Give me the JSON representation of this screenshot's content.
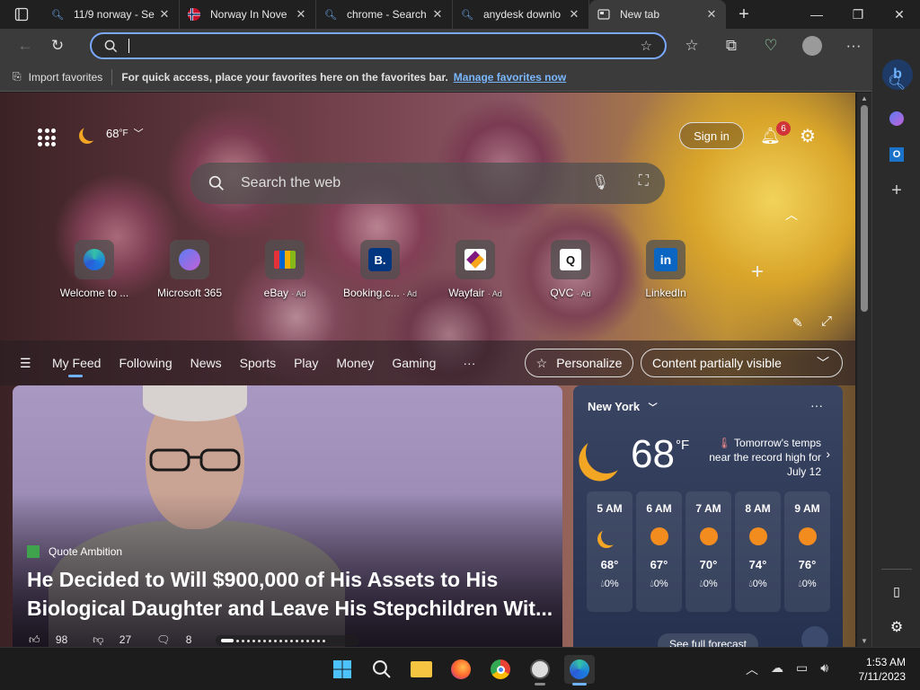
{
  "tabs": [
    {
      "label": "11/9 norway - Se",
      "icon": "search-favicon"
    },
    {
      "label": "Norway In Nove",
      "icon": "norway-flag-favicon"
    },
    {
      "label": "chrome - Search",
      "icon": "search-favicon"
    },
    {
      "label": "anydesk downlo",
      "icon": "search-favicon"
    },
    {
      "label": "New tab",
      "icon": "newtab-favicon",
      "active": true
    }
  ],
  "address": {
    "value": ""
  },
  "favorites_bar": {
    "import_label": "Import favorites",
    "message": "For quick access, place your favorites here on the favorites bar.",
    "manage_link": "Manage favorites now"
  },
  "header": {
    "weather_temp": "68",
    "weather_unit": "°F",
    "signin_label": "Sign in",
    "notification_count": "6"
  },
  "search": {
    "placeholder": "Search the web"
  },
  "quick_links": [
    {
      "label": "Welcome to ...",
      "ad": ""
    },
    {
      "label": "Microsoft 365",
      "ad": ""
    },
    {
      "label": "eBay",
      "ad": "· Ad"
    },
    {
      "label": "Booking.c...",
      "ad": "· Ad"
    },
    {
      "label": "Wayfair",
      "ad": "· Ad"
    },
    {
      "label": "QVC",
      "ad": "· Ad"
    },
    {
      "label": "LinkedIn",
      "ad": ""
    }
  ],
  "feed_tabs": [
    "My Feed",
    "Following",
    "News",
    "Sports",
    "Play",
    "Money",
    "Gaming",
    "···"
  ],
  "personalize_label": "Personalize",
  "content_visibility": "Content partially visible",
  "article": {
    "source": "Quote Ambition",
    "headline": "He Decided to Will $900,000 of His Assets to His Biological Daughter and Leave His Stepchildren Wit...",
    "likes": "98",
    "dislikes": "27",
    "comments": "8"
  },
  "weather": {
    "city": "New York",
    "temp": "68",
    "unit": "°F",
    "note": "Tomorrow's temps near the record high for July 12",
    "hours": [
      {
        "time": "5 AM",
        "temp": "68°",
        "precip": "0%",
        "icon": "moon"
      },
      {
        "time": "6 AM",
        "temp": "67°",
        "precip": "0%",
        "icon": "sun"
      },
      {
        "time": "7 AM",
        "temp": "70°",
        "precip": "0%",
        "icon": "sun"
      },
      {
        "time": "8 AM",
        "temp": "74°",
        "precip": "0%",
        "icon": "sun"
      },
      {
        "time": "9 AM",
        "temp": "76°",
        "precip": "0%",
        "icon": "sun"
      }
    ],
    "full_forecast": "See full forecast"
  },
  "taskbar": {
    "time": "1:53 AM",
    "date": "7/11/2023"
  },
  "colors": {
    "accent": "#6fb3ff",
    "badge": "#d13438"
  }
}
